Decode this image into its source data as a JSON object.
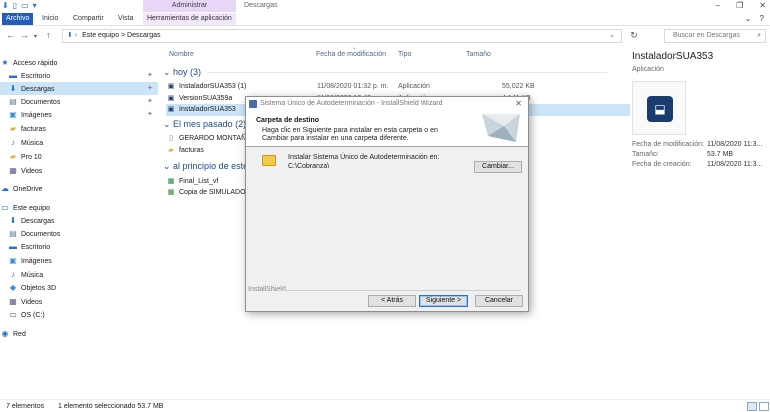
{
  "titlebar": {
    "context_tab": "Administrar",
    "title": "Descargas",
    "controls": [
      "–",
      "❐",
      "✕"
    ]
  },
  "ribbon": {
    "tabs": [
      "Archivo",
      "Inicio",
      "Compartir",
      "Vista",
      "Herramientas de aplicación"
    ],
    "active_tab": "Archivo"
  },
  "address": {
    "path": "Este equipo  >  Descargas",
    "search_placeholder": "Buscar en Descargas"
  },
  "nav": {
    "quick_access": "Acceso rápido",
    "items": [
      {
        "label": "Escritorio",
        "icon": "desktop-icon",
        "pinned": true
      },
      {
        "label": "Descargas",
        "icon": "download-icon",
        "pinned": true,
        "selected": true
      },
      {
        "label": "Documentos",
        "icon": "document-icon",
        "pinned": true
      },
      {
        "label": "Imágenes",
        "icon": "image-icon",
        "pinned": true
      },
      {
        "label": "facturas",
        "icon": "folder-icon"
      },
      {
        "label": "Música",
        "icon": "music-icon"
      },
      {
        "label": "Pro 10",
        "icon": "folder-icon"
      },
      {
        "label": "Videos",
        "icon": "video-icon"
      }
    ],
    "onedrive": "OneDrive",
    "this_pc": "Este equipo",
    "pc_items": [
      {
        "label": "Descargas",
        "icon": "download-icon"
      },
      {
        "label": "Documentos",
        "icon": "document-icon"
      },
      {
        "label": "Escritorio",
        "icon": "desktop-icon"
      },
      {
        "label": "Imágenes",
        "icon": "image-icon"
      },
      {
        "label": "Música",
        "icon": "music-icon"
      },
      {
        "label": "Objetos 3D",
        "icon": "cube-icon"
      },
      {
        "label": "Videos",
        "icon": "video-icon"
      },
      {
        "label": "OS (C:)",
        "icon": "drive-icon"
      }
    ],
    "network": "Red"
  },
  "columns": {
    "name": "Nombre",
    "modified": "Fecha de modificación",
    "type": "Tipo",
    "size": "Tamaño"
  },
  "groups": [
    {
      "label": "hoy (3)",
      "rows": [
        {
          "name": "InstaladorSUA353 (1)",
          "date": "11/08/2020 01:32 p. m.",
          "type": "Aplicación",
          "size": "55,022 KB"
        },
        {
          "name": "VersionSUA359a",
          "date": "11/08/2020 10:43 a. m.",
          "type": "Aplicación",
          "size": "4,141 KB"
        },
        {
          "name": "InstaladorSUA353",
          "date": "",
          "type": "",
          "size": "",
          "selected": true
        }
      ]
    },
    {
      "label": "El mes pasado (2)",
      "rows": [
        {
          "name": "GERARDO MONTAÑO",
          "date": "",
          "type": "",
          "size": ""
        },
        {
          "name": "facturas",
          "date": "",
          "type": "",
          "size": ""
        }
      ]
    },
    {
      "label": "al principio de este a",
      "rows": [
        {
          "name": "Final_List_vf",
          "date": "",
          "type": "",
          "size": ""
        },
        {
          "name": "Copia de SIMULADOR",
          "date": "",
          "type": "",
          "size": ""
        }
      ]
    }
  ],
  "details": {
    "name": "InstaladorSUA353",
    "type": "Aplicación",
    "props": [
      {
        "label": "Fecha de modificación:",
        "value": "11/08/2020 11:3..."
      },
      {
        "label": "Tamaño:",
        "value": "53.7 MB"
      },
      {
        "label": "Fecha de creación:",
        "value": "11/08/2020 11:3..."
      }
    ]
  },
  "status": {
    "count": "7 elementos",
    "selection": "1 elemento seleccionado  53.7 MB"
  },
  "dialog": {
    "title": "Sistema Único de Autodeterminación - InstallShield Wizard",
    "heading": "Carpeta de destino",
    "description": "Haga clic en Siguiente para instalar en esta carpeta o en Cambiar para instalar en una carpeta diferente.",
    "install_label": "Instalar Sistema Único de Autodeterminación en:",
    "install_path": "C:\\Cobranza\\",
    "change_button": "Cambiar...",
    "brand": "InstallShield",
    "back_button": "< Atrás",
    "next_button": "Siguiente >",
    "cancel_button": "Cancelar"
  }
}
